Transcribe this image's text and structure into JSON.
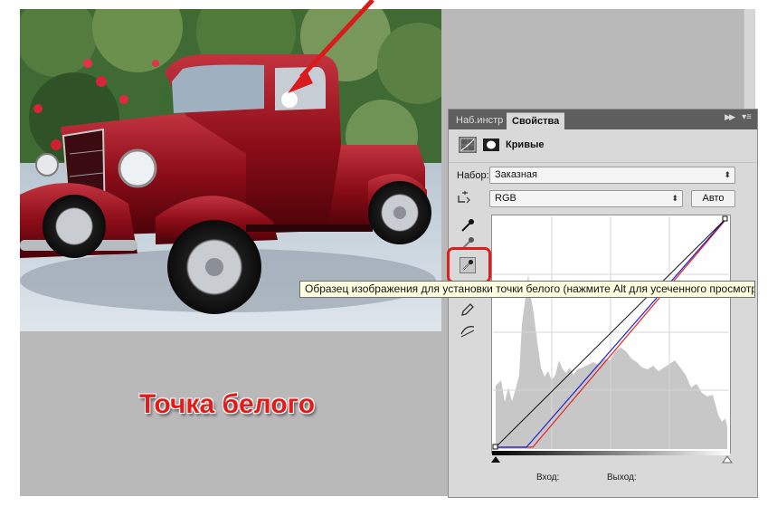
{
  "caption": "Точка белого",
  "panel": {
    "tabs": [
      {
        "label": "Наб.инстр",
        "active": false
      },
      {
        "label": "Свойства",
        "active": true
      }
    ],
    "collapse_icon": "double-chevron-right",
    "menu_icon": "panel-menu",
    "title": "Кривые",
    "preset_label": "Набор:",
    "preset_value": "Заказная",
    "channel_value": "RGB",
    "auto_label": "Авто",
    "input_label": "Вход:",
    "output_label": "Выход:"
  },
  "tooltip": "Образец изображения для установки точки белого (нажмите Alt для усеченного просмотра)",
  "colors": {
    "highlight": "#e01d1d",
    "caption": "#e21b1b",
    "tooltip_bg": "#ffffe1",
    "curve_red": "#e22222",
    "curve_blue": "#2222d0"
  }
}
